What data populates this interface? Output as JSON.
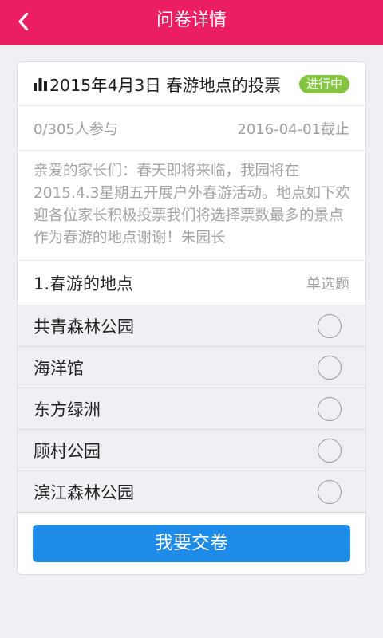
{
  "header": {
    "title": "问卷详情",
    "back_icon": "chevron-left-icon",
    "color": "#EB1E63"
  },
  "survey": {
    "title_icon": "bar-chart-icon",
    "title": "2015年4月3日 春游地点的投票",
    "status": "进行中",
    "status_color": "#84C441",
    "participation": "0/305人参与",
    "deadline": "2016-04-01截止",
    "description_lines": [
      "亲爱的家长们：春天即将来临，我园将在",
      "2015.4.3星期五开展户外春游活动。地点如下欢",
      "迎各位家长积极投票我们将选择票数最多的景点",
      "作为春游的地点谢谢！朱园长"
    ]
  },
  "question": {
    "title": "1.春游的地点",
    "type": "单选题",
    "options": [
      {
        "label": "共青森林公园",
        "selected": false
      },
      {
        "label": "海洋馆",
        "selected": false
      },
      {
        "label": "东方绿洲",
        "selected": false
      },
      {
        "label": "顾村公园",
        "selected": false
      },
      {
        "label": "滨江森林公园",
        "selected": false
      }
    ]
  },
  "submit": {
    "label": "我要交卷",
    "color": "#1E8BE8"
  }
}
